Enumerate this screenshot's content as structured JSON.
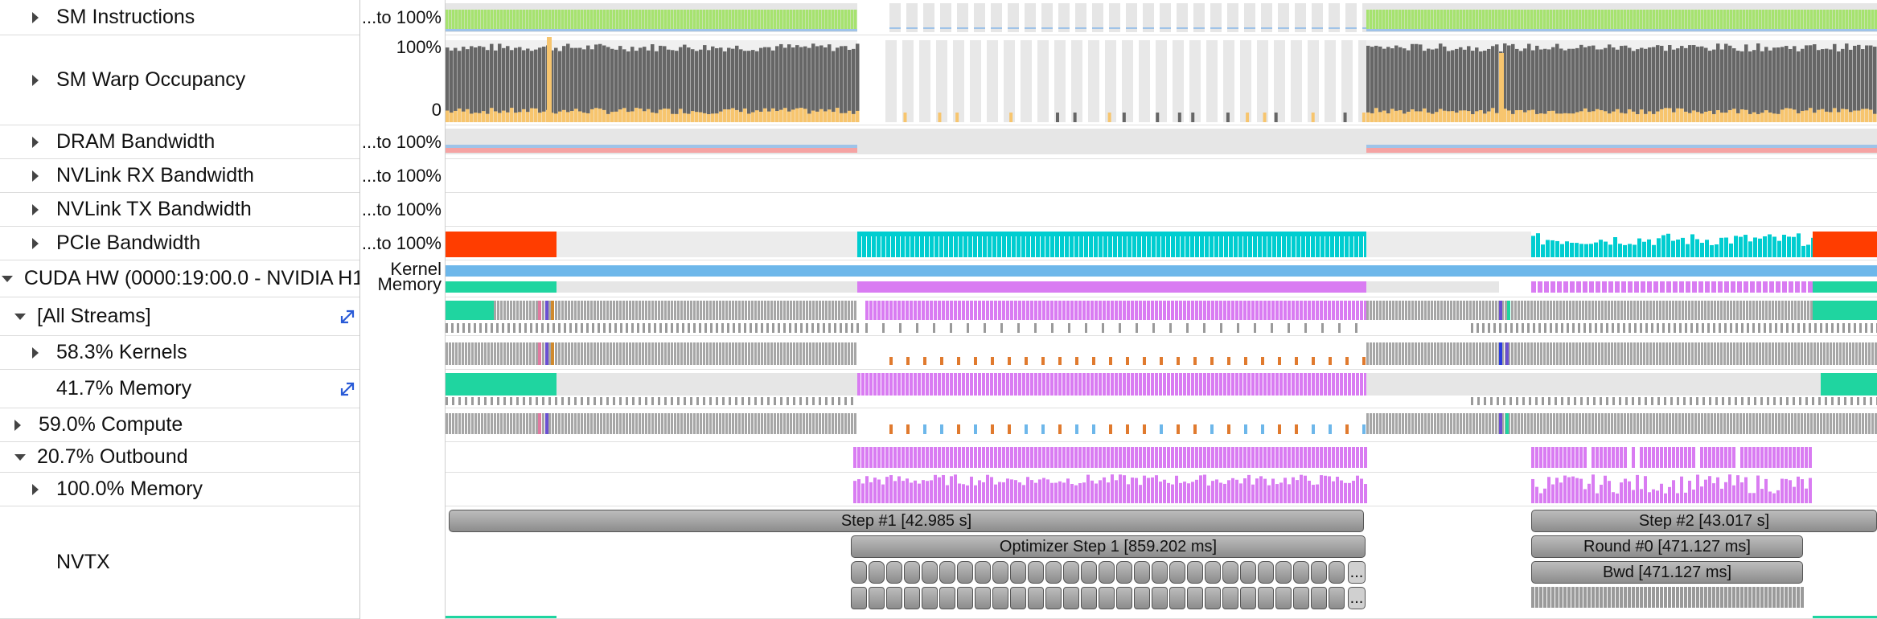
{
  "rows": [
    {
      "label": "SM Instructions",
      "caret": "right",
      "scale": "...to 100%"
    },
    {
      "label": "SM Warp Occupancy",
      "caret": "right",
      "scale_top": "100%",
      "scale_bottom": "0"
    },
    {
      "label": "DRAM Bandwidth",
      "caret": "right",
      "scale": "...to 100%"
    },
    {
      "label": "NVLink RX Bandwidth",
      "caret": "right",
      "scale": "...to 100%"
    },
    {
      "label": "NVLink TX Bandwidth",
      "caret": "right",
      "scale": "...to 100%"
    },
    {
      "label": "PCIe Bandwidth",
      "caret": "right",
      "scale": "...to 100%"
    },
    {
      "label": "CUDA HW (0000:19:00.0 - NVIDIA H1",
      "caret": "down",
      "scale_top": "Kernel",
      "scale_bottom": "Memory"
    },
    {
      "label": "[All Streams]",
      "caret": "down",
      "icon": "expand-icon"
    },
    {
      "label": "58.3% Kernels",
      "caret": "right"
    },
    {
      "label": "41.7% Memory",
      "caret": "none",
      "icon": "expand-icon"
    },
    {
      "label": "59.0% Compute",
      "caret": "right"
    },
    {
      "label": "20.7% Outbound",
      "caret": "down"
    },
    {
      "label": "100.0% Memory",
      "caret": "right"
    },
    {
      "label": "NVTX",
      "caret": "none"
    }
  ],
  "nvtx": {
    "step1": "Step #1 [42.985 s]",
    "step2": "Step #2 [43.017 s]",
    "optimizer": "Optimizer Step 1 [859.202 ms]",
    "round0": "Round #0 [471.127 ms]",
    "bwd": "Bwd [471.127 ms]",
    "more1": "...",
    "more2": "..."
  },
  "colors": {
    "sm_green": "#a6e36f",
    "occupancy_gray": "#666666",
    "occupancy_orange": "#f7c56e",
    "pcie_red": "#ff3d00",
    "pcie_cyan": "#00cdd0",
    "kernel_blue": "#6db7ea",
    "memory_teal": "#1fd5a0",
    "memory_magenta": "#d97cf2",
    "kernel_gray": "#a6a6a6",
    "outbound_magenta": "#d97cf2",
    "dram_pink": "#f5a3a3",
    "nvtx_gray": "#9a9a9a"
  }
}
